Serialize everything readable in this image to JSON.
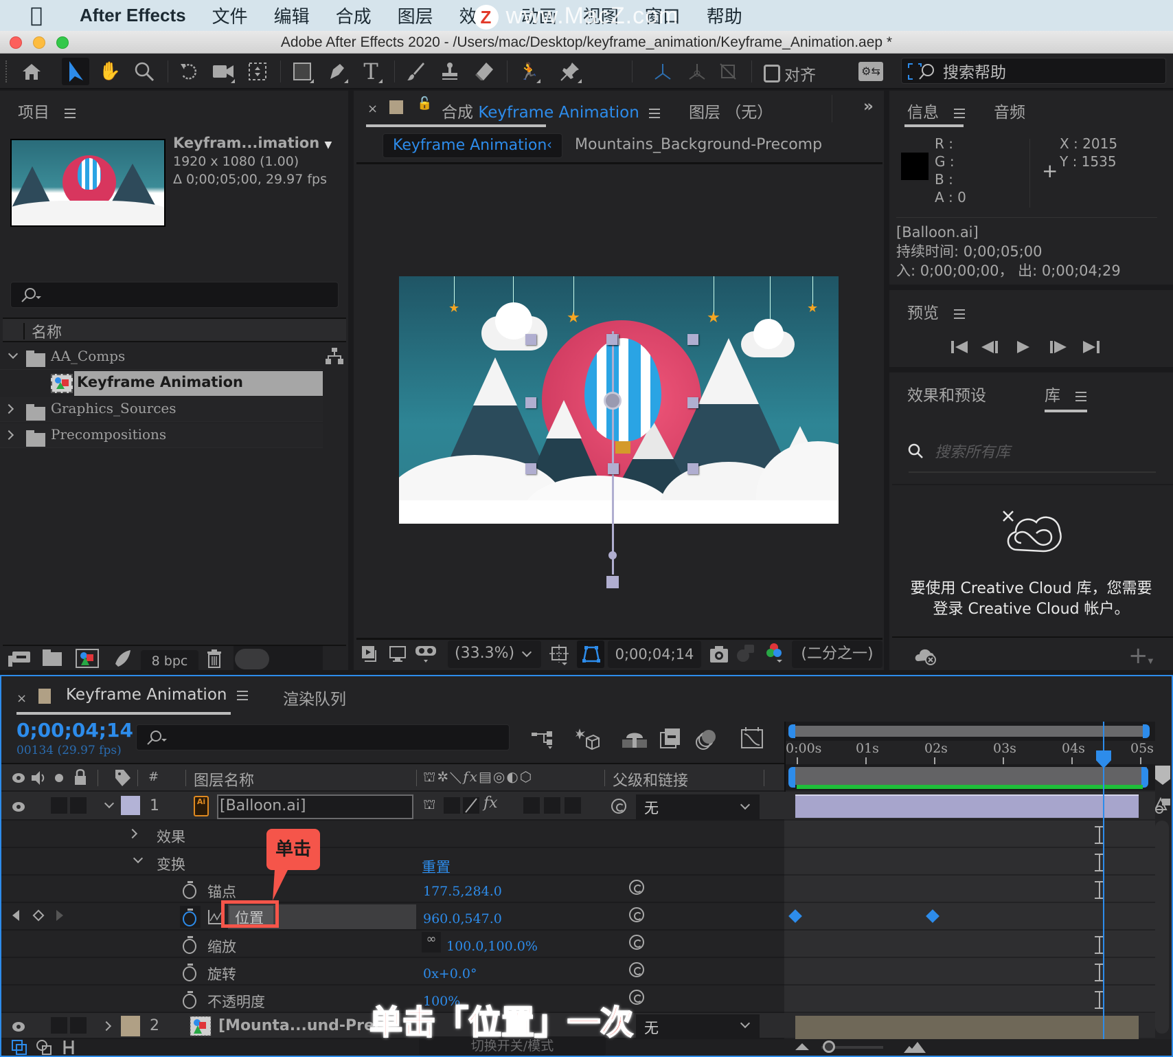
{
  "menubar": {
    "app_name": "After Effects",
    "items": [
      "文件",
      "编辑",
      "合成",
      "图层",
      "效果",
      "动画",
      "视图",
      "窗口",
      "帮助"
    ],
    "watermark": "www.MacZ.com"
  },
  "window": {
    "title": "Adobe After Effects 2020 - /Users/mac/Desktop/keyframe_animation/Keyframe_Animation.aep *"
  },
  "toolbar": {
    "tools": [
      "home",
      "selection",
      "hand",
      "zoom",
      "rotate",
      "camera",
      "pan-behind",
      "rectangle",
      "pen",
      "type",
      "brush",
      "clone-stamp",
      "eraser",
      "roto-brush",
      "puppet-pin"
    ],
    "align_label": "对齐",
    "search_help_placeholder": "搜索帮助"
  },
  "project_panel": {
    "tab_label": "项目",
    "preview": {
      "name": "Keyfram...imation",
      "resolution": "1920 x 1080 (1.00)",
      "duration": "Δ 0;00;05;00, 29.97 fps"
    },
    "search_placeholder": "",
    "column_name": "名称",
    "items": [
      {
        "label": "AA_Comps",
        "type": "folder",
        "expanded": true,
        "level": 0
      },
      {
        "label": "Keyframe Animation",
        "type": "composition",
        "selected": true,
        "level": 1
      },
      {
        "label": "Graphics_Sources",
        "type": "folder",
        "expanded": false,
        "level": 0
      },
      {
        "label": "Precompositions",
        "type": "folder",
        "expanded": false,
        "level": 0
      }
    ],
    "bpc_label": "8 bpc"
  },
  "comp_panel": {
    "tab_prefix": "合成",
    "tab_comp_name": "Keyframe Animation",
    "layer_tab": "图层 （无）",
    "breadcrumb_active": "Keyframe Animation",
    "breadcrumb_next": "Mountains_Background-Precomp",
    "zoom_level": "(33.3%)",
    "current_time": "0;00;04;14",
    "resolution": "(二分之一)"
  },
  "info_panel": {
    "tab_info": "信息",
    "tab_audio": "音频",
    "r_label": "R :",
    "g_label": "G :",
    "b_label": "B :",
    "a_label": "A :  0",
    "x_label": "X : 2015",
    "y_label": "Y :  1535",
    "layer_name": "[Balloon.ai]",
    "duration": "持续时间: 0;00;05;00",
    "in_out": "入: 0;00;00;00， 出: 0;00;04;29"
  },
  "preview_panel": {
    "tab_label": "预览"
  },
  "libraries_panel": {
    "tab_effects": "效果和预设",
    "tab_library": "库",
    "search_placeholder": "搜索所有库",
    "message_line1": "要使用 Creative Cloud 库，您需要",
    "message_line2": "登录 Creative Cloud 帐户。"
  },
  "timeline": {
    "tab_comp": "Keyframe Animation",
    "tab_render": "渲染队列",
    "timecode": "0;00;04;14",
    "frame_info": "00134 (29.97 fps)",
    "col_num": "#",
    "col_layer_name": "图层名称",
    "col_parent": "父级和链接",
    "layers": [
      {
        "num": "1",
        "name": "[Balloon.ai]",
        "parent": "无",
        "label_color": "#b3b3d6"
      },
      {
        "num": "2",
        "name": "[Mounta...und-Prec",
        "parent": "无",
        "label_color": "#b0a085"
      }
    ],
    "effects_label": "效果",
    "transform_label": "变换",
    "reset_label": "重置",
    "properties": [
      {
        "name": "锚点",
        "value": "177.5,284.0"
      },
      {
        "name": "位置",
        "value": "960.0,547.0",
        "active": true
      },
      {
        "name": "缩放",
        "value": "100.0,100.0%"
      },
      {
        "name": "旋转",
        "value": "0x+0.0°"
      },
      {
        "name": "不透明度",
        "value": "100%"
      }
    ],
    "ruler": [
      "0:00s",
      "01s",
      "02s",
      "03s",
      "04s",
      "05s"
    ],
    "playhead_seconds": 4.47,
    "duration_seconds": 5,
    "position_keyframes_seconds": [
      0,
      2
    ],
    "toggle_label": "切换开关/模式"
  },
  "annotations": {
    "callout": "单击",
    "caption": "单击「位置」一次",
    "color": "#f5554a"
  }
}
